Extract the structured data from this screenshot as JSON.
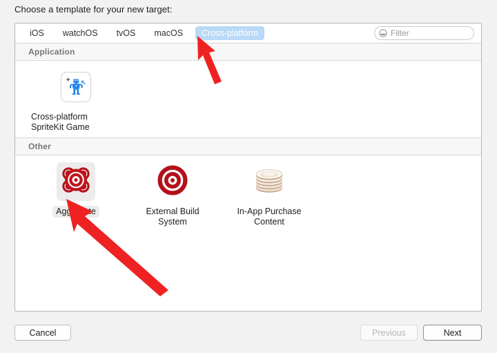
{
  "dialog": {
    "prompt": "Choose a template for your new target:"
  },
  "tabs": [
    {
      "label": "iOS",
      "selected": false
    },
    {
      "label": "watchOS",
      "selected": false
    },
    {
      "label": "tvOS",
      "selected": false
    },
    {
      "label": "macOS",
      "selected": false
    },
    {
      "label": "Cross-platform",
      "selected": true
    }
  ],
  "filter": {
    "placeholder": "Filter",
    "value": "",
    "icon": "filter-circle-icon"
  },
  "sections": [
    {
      "title": "Application",
      "items": [
        {
          "label": "Cross-platform\nSpriteKit Game",
          "icon": "spritekit-robot-icon",
          "selected": false,
          "align": "left"
        }
      ]
    },
    {
      "title": "Other",
      "items": [
        {
          "label": "Aggregate",
          "icon": "aggregate-target-icon",
          "selected": true,
          "align": "center"
        },
        {
          "label": "External Build\nSystem",
          "icon": "target-bullseye-icon",
          "selected": false,
          "align": "center"
        },
        {
          "label": "In-App Purchase\nContent",
          "icon": "iap-disc-stack-icon",
          "selected": false,
          "align": "center"
        }
      ]
    }
  ],
  "buttons": {
    "cancel": "Cancel",
    "previous": "Previous",
    "next": "Next"
  },
  "annotations": {
    "arrow_color": "#ee2222",
    "arrows": [
      {
        "name": "arrow-to-cross-platform-tab",
        "target": "Cross-platform"
      },
      {
        "name": "arrow-to-aggregate-item",
        "target": "Aggregate"
      }
    ]
  }
}
